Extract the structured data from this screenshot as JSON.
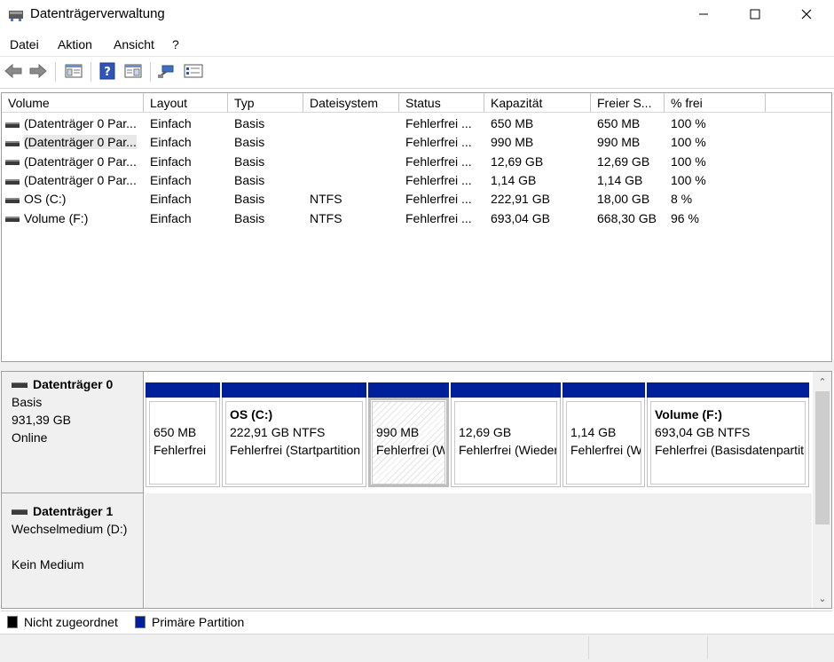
{
  "window": {
    "title": "Datenträgerverwaltung",
    "minimize_icon": "minimize-icon",
    "maximize_icon": "maximize-icon",
    "close_icon": "close-icon"
  },
  "menu": [
    "Datei",
    "Aktion",
    "Ansicht",
    "?"
  ],
  "toolbar": {
    "icons": [
      "back-arrow-icon",
      "forward-arrow-icon",
      "console-tree-icon",
      "help-icon",
      "action-pane-icon",
      "connect-icon",
      "properties-icon"
    ]
  },
  "volume_table": {
    "headers": [
      "Volume",
      "Layout",
      "Typ",
      "Dateisystem",
      "Status",
      "Kapazität",
      "Freier S...",
      "% frei"
    ],
    "rows": [
      [
        "(Datenträger 0 Par...",
        "Einfach",
        "Basis",
        "",
        "Fehlerfrei ...",
        "650 MB",
        "650 MB",
        "100 %"
      ],
      [
        "(Datenträger 0 Par...",
        "Einfach",
        "Basis",
        "",
        "Fehlerfrei ...",
        "990 MB",
        "990 MB",
        "100 %"
      ],
      [
        "(Datenträger 0 Par...",
        "Einfach",
        "Basis",
        "",
        "Fehlerfrei ...",
        "12,69 GB",
        "12,69 GB",
        "100 %"
      ],
      [
        "(Datenträger 0 Par...",
        "Einfach",
        "Basis",
        "",
        "Fehlerfrei ...",
        "1,14 GB",
        "1,14 GB",
        "100 %"
      ],
      [
        "OS (C:)",
        "Einfach",
        "Basis",
        "NTFS",
        "Fehlerfrei ...",
        "222,91 GB",
        "18,00 GB",
        "8 %"
      ],
      [
        "Volume (F:)",
        "Einfach",
        "Basis",
        "NTFS",
        "Fehlerfrei ...",
        "693,04 GB",
        "668,30 GB",
        "96 %"
      ]
    ],
    "selected_row": 1
  },
  "disks": [
    {
      "name": "Datenträger 0",
      "type": "Basis",
      "size": "931,39 GB",
      "status": "Online",
      "partitions": [
        {
          "name": "",
          "size": "650 MB",
          "status": "Fehlerfrei"
        },
        {
          "name": "OS  (C:)",
          "size": "222,91 GB NTFS",
          "status": "Fehlerfrei (Startpartition"
        },
        {
          "name": "",
          "size": "990 MB",
          "status": "Fehlerfrei (Wiederherstellungspartition)",
          "selected": true
        },
        {
          "name": "",
          "size": "12,69 GB",
          "status": "Fehlerfrei (Wiederherstellungspartition)"
        },
        {
          "name": "",
          "size": "1,14 GB",
          "status": "Fehlerfrei (Wiederherstellungspartition)"
        },
        {
          "name": "Volume  (F:)",
          "size": "693,04 GB NTFS",
          "status": "Fehlerfrei (Basisdatenpartition)"
        }
      ]
    },
    {
      "name": "Datenträger 1",
      "type": "Wechselmedium (D:)",
      "size": "",
      "status": "Kein Medium",
      "partitions": []
    }
  ],
  "legend": [
    {
      "label": "Nicht zugeordnet",
      "color": "#000000"
    },
    {
      "label": "Primäre Partition",
      "color": "#001f9a"
    }
  ],
  "colors": {
    "primary_partition": "#001f9a",
    "unallocated": "#000000"
  }
}
